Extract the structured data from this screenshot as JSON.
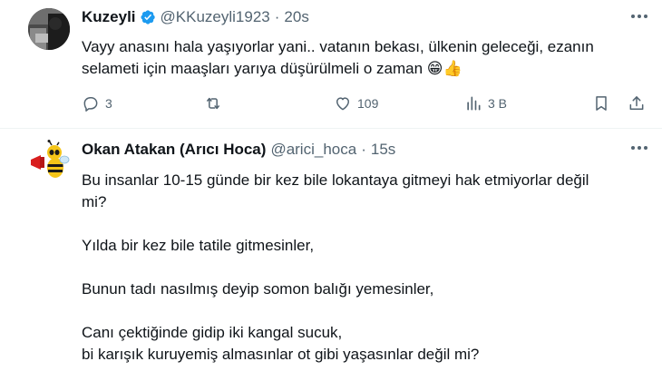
{
  "tweets": [
    {
      "name": "Kuzeyli",
      "handle": "@KKuzeyli1923",
      "dot": "·",
      "time": "20s",
      "lines": [
        "Vayy anasını hala yaşıyorlar yani.. vatanın bekası, ülkenin geleceği, ezanın",
        "selameti için maaşları yarıya düşürülmeli o zaman 😁👍"
      ],
      "actions": {
        "reply": "3",
        "retweet": "",
        "like": "109",
        "views": "3 B"
      },
      "icons": {
        "verified": "verified-badge-icon",
        "more": "more-options-icon",
        "reply": "reply-icon",
        "retweet": "retweet-icon",
        "like": "heart-icon",
        "views": "views-chart-icon",
        "bookmark": "bookmark-icon",
        "share": "share-icon"
      }
    },
    {
      "name": "Okan Atakan (Arıcı Hoca)",
      "handle": "@arici_hoca",
      "dot": "·",
      "time": "15s",
      "paragraphs": [
        [
          "Bu insanlar 10-15 günde bir kez bile lokantaya gitmeyi hak etmiyorlar değil",
          "mi?"
        ],
        [
          "Yılda bir kez bile tatile gitmesinler,"
        ],
        [
          "Bunun tadı nasılmış deyip somon balığı yemesinler,"
        ],
        [
          "Canı çektiğinde gidip iki kangal sucuk,",
          "bi karışık kuruyemiş almasınlar ot gibi yaşasınlar değil mi?"
        ]
      ]
    }
  ],
  "colors": {
    "text": "#0f1419",
    "muted": "#536471",
    "verified": "#1d9bf0",
    "divider": "#eff3f4"
  }
}
